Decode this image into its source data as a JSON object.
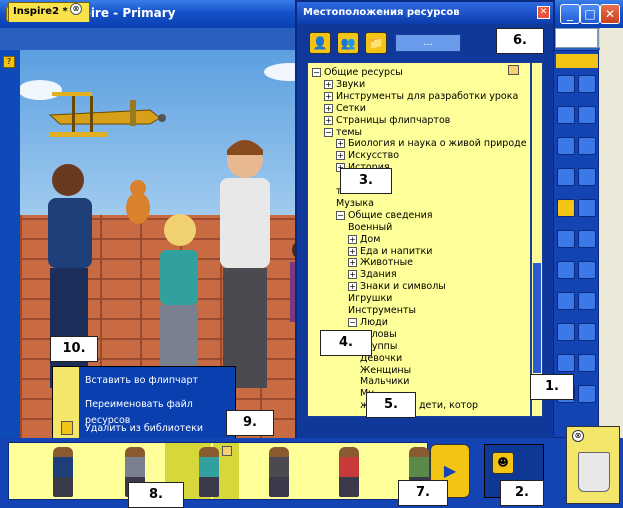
{
  "main_window": {
    "title": "ActivInspire - Primary",
    "minimize": "_",
    "maximize": "□",
    "close": "✕"
  },
  "doc_tab": {
    "label": "Inspire2 *",
    "close": "⊗"
  },
  "resources_dialog": {
    "title": "Местоположения ресурсов",
    "close": "✕",
    "ellipsis": "...",
    "tree": [
      {
        "label": "Общие ресурсы",
        "expander": "−",
        "level": 0
      },
      {
        "label": "Звуки",
        "expander": "+",
        "level": 1
      },
      {
        "label": "Инструменты для разработки урока",
        "expander": "+",
        "level": 1
      },
      {
        "label": "Сетки",
        "expander": "+",
        "level": 1
      },
      {
        "label": "Страницы флипчартов",
        "expander": "+",
        "level": 1
      },
      {
        "label": "темы",
        "expander": "−",
        "level": 1
      },
      {
        "label": "Биология и наука о живой природе",
        "expander": "+",
        "level": 2
      },
      {
        "label": "Искусство",
        "expander": "+",
        "level": 2
      },
      {
        "label": "История",
        "expander": "+",
        "level": 2
      },
      {
        "label": "",
        "expander": "",
        "level": 2
      },
      {
        "label": "тика",
        "expander": "",
        "level": 2
      },
      {
        "label": "Музыка",
        "expander": "",
        "level": 2
      },
      {
        "label": "Общие сведения",
        "expander": "−",
        "level": 2
      },
      {
        "label": "Военный",
        "expander": "",
        "level": 3
      },
      {
        "label": "Дом",
        "expander": "+",
        "level": 3
      },
      {
        "label": "Еда и напитки",
        "expander": "+",
        "level": 3
      },
      {
        "label": "Животные",
        "expander": "+",
        "level": 3
      },
      {
        "label": "Здания",
        "expander": "+",
        "level": 3
      },
      {
        "label": "Знаки и символы",
        "expander": "+",
        "level": 3
      },
      {
        "label": "Игрушки",
        "expander": "",
        "level": 3
      },
      {
        "label": "Инструменты",
        "expander": "",
        "level": 3
      },
      {
        "label": "Люди",
        "expander": "−",
        "level": 3
      },
      {
        "label": "Головы",
        "expander": "",
        "level": 4
      },
      {
        "label": "Группы",
        "expander": "",
        "level": 4
      },
      {
        "label": "Девочки",
        "expander": "",
        "level": 4
      },
      {
        "label": "Женщины",
        "expander": "",
        "level": 4
      },
      {
        "label": "Мальчики",
        "expander": "",
        "level": 4
      },
      {
        "label": "Му",
        "expander": "",
        "level": 4
      },
      {
        "label": "жденные и дети, котор",
        "expander": "",
        "level": 4
      }
    ]
  },
  "context_menu": {
    "items": [
      "Вставить во флипчарт",
      "Переименовать файл ресурсов",
      "Удалить из библиотеки"
    ]
  },
  "callouts": [
    "1.",
    "2.",
    "3.",
    "4.",
    "5.",
    "6.",
    "7.",
    "8.",
    "9.",
    "10."
  ],
  "colors": {
    "titlebar": "#1452C9",
    "panel_blue": "#1443B3",
    "tree_bg": "#FFFF99",
    "accent_yellow": "#F4C414"
  },
  "icons": [
    "user-icon",
    "users-icon",
    "folder-icon",
    "play-icon",
    "resource-library-icon",
    "trash-icon"
  ]
}
